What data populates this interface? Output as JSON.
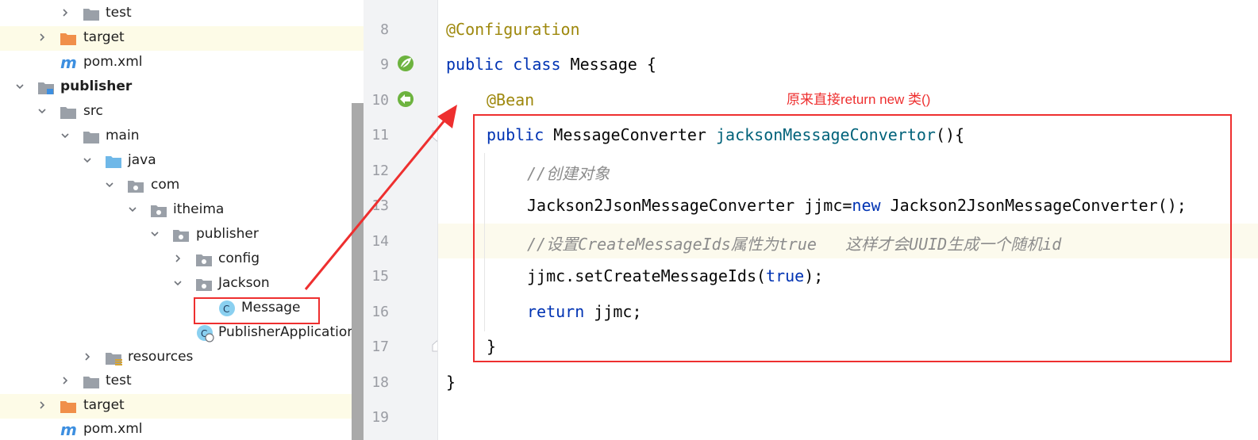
{
  "project_tree": {
    "items": [
      {
        "label": "test",
        "kind": "folder",
        "expanded": false,
        "highlighted": false
      },
      {
        "label": "target",
        "kind": "folder-excluded",
        "expanded": false,
        "highlighted": true
      },
      {
        "label": "pom.xml",
        "kind": "maven",
        "highlighted": false
      },
      {
        "label": "publisher",
        "kind": "module",
        "expanded": true,
        "highlighted": false
      },
      {
        "label": "src",
        "kind": "folder",
        "expanded": true,
        "highlighted": false
      },
      {
        "label": "main",
        "kind": "folder",
        "expanded": true,
        "highlighted": false
      },
      {
        "label": "java",
        "kind": "folder-source",
        "expanded": true,
        "highlighted": false
      },
      {
        "label": "com",
        "kind": "package",
        "expanded": true,
        "highlighted": false
      },
      {
        "label": "itheima",
        "kind": "package",
        "expanded": true,
        "highlighted": false
      },
      {
        "label": "publisher",
        "kind": "package",
        "expanded": true,
        "highlighted": false
      },
      {
        "label": "config",
        "kind": "package",
        "expanded": false,
        "highlighted": false
      },
      {
        "label": "Jackson",
        "kind": "package",
        "expanded": true,
        "highlighted": false
      },
      {
        "label": "Message",
        "kind": "class",
        "highlighted": false
      },
      {
        "label": "PublisherApplication",
        "kind": "spring-class",
        "highlighted": false
      },
      {
        "label": "resources",
        "kind": "folder-resources",
        "expanded": false,
        "highlighted": false
      },
      {
        "label": "test",
        "kind": "folder",
        "expanded": false,
        "highlighted": false
      },
      {
        "label": "target",
        "kind": "folder-excluded",
        "expanded": false,
        "highlighted": true
      },
      {
        "label": "pom.xml",
        "kind": "maven",
        "highlighted": false
      }
    ]
  },
  "editor": {
    "line_numbers": [
      "8",
      "9",
      "10",
      "11",
      "12",
      "13",
      "14",
      "15",
      "16",
      "17",
      "18",
      "19"
    ],
    "current_line": "14",
    "lines": {
      "l8": {
        "annotation": "@Configuration"
      },
      "l9": {
        "kw1": "public",
        "kw2": "class",
        "rest": " Message {"
      },
      "l10": {
        "annotation": "@Bean"
      },
      "l11": {
        "kw": "public",
        "type": " MessageConverter ",
        "method": "jacksonMessageConvertor",
        "rest": "(){"
      },
      "l12": {
        "comment": "//创建对象"
      },
      "l13": {
        "pre": "Jackson2JsonMessageConverter jjmc=",
        "kw": "new",
        "post": " Jackson2JsonMessageConverter();"
      },
      "l14": {
        "comment": "//设置CreateMessageIds属性为true   这样才会UUID生成一个随机id"
      },
      "l15": {
        "pre": "jjmc.setCreateMessageIds(",
        "kw": "true",
        "post": ");"
      },
      "l16": {
        "kw": "return",
        "post": " jjmc;"
      },
      "l17": {
        "text": "}"
      },
      "l18": {
        "text": "}"
      }
    }
  },
  "annotation_note": "原来直接return new 类()",
  "colors": {
    "annotation_red": "#ee2f2f",
    "keyword": "#0033b3",
    "annotation": "#9e880d",
    "method": "#00627a",
    "comment": "#8c8c8c",
    "spring_green": "#6db33f"
  },
  "icons": {
    "gutter_line9": "spring-bean-icon",
    "gutter_line10": "spring-bean-method-icon",
    "gutter_line14": "lightbulb-icon"
  }
}
